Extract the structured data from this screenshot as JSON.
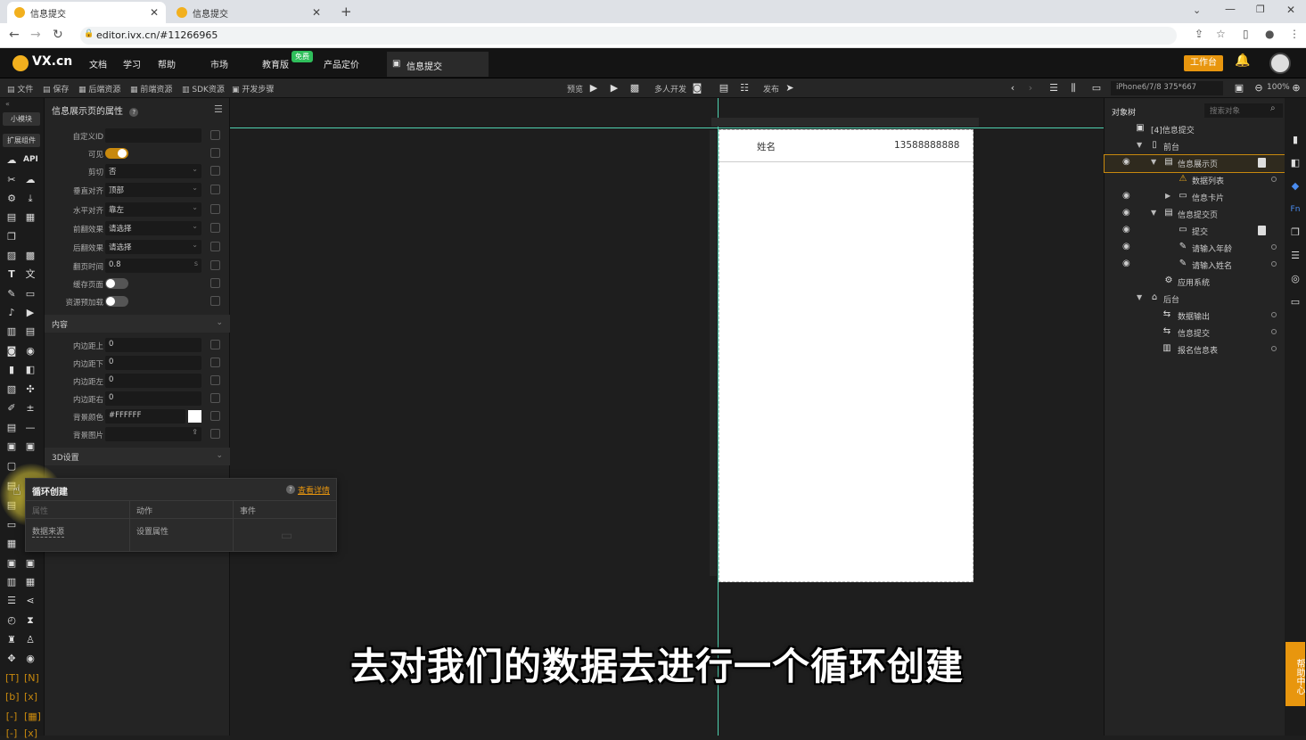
{
  "browser": {
    "tabs": [
      {
        "title": "信息提交"
      },
      {
        "title": "信息提交"
      }
    ],
    "url": "editor.ivx.cn/#11266965"
  },
  "app": {
    "logo": "VX.cn",
    "menu": [
      "文档",
      "学习",
      "帮助",
      "市场",
      "教育版",
      "产品定价"
    ],
    "menu_badge": "免费",
    "active_page_tab": "信息提交",
    "workbench_button": "工作台",
    "toolbar_left": [
      "文件",
      "保存",
      "后端资源",
      "前端资源",
      "SDK资源",
      "开发步骤"
    ],
    "preview_label": "预览",
    "multi_dev_label": "多人开发",
    "publish_label": "发布",
    "device_label": "iPhone6/7/8 375*667",
    "zoom_label": "100%"
  },
  "left_sidebar": {
    "tabs": [
      "小模块",
      "扩展组件"
    ],
    "api_label": "API"
  },
  "props_panel": {
    "title": "信息展示页的属性",
    "rows": [
      {
        "label": "自定义ID",
        "value": ""
      },
      {
        "label": "可见",
        "value": ""
      },
      {
        "label": "剪切",
        "value": "否"
      },
      {
        "label": "垂直对齐",
        "value": "顶部"
      },
      {
        "label": "水平对齐",
        "value": "靠左"
      },
      {
        "label": "前翻效果",
        "value": "请选择"
      },
      {
        "label": "后翻效果",
        "value": "请选择"
      },
      {
        "label": "翻页时间",
        "value": "0.8"
      },
      {
        "label": "缓存页面",
        "value": ""
      },
      {
        "label": "资源预加载",
        "value": ""
      }
    ],
    "page_time_unit": "s",
    "section_content": "内容",
    "content_rows": [
      {
        "label": "内边距上",
        "value": "0"
      },
      {
        "label": "内边距下",
        "value": "0"
      },
      {
        "label": "内边距左",
        "value": "0"
      },
      {
        "label": "内边距右",
        "value": "0"
      },
      {
        "label": "背景颜色",
        "value": "#FFFFFF"
      },
      {
        "label": "背景图片",
        "value": ""
      }
    ],
    "section_3d": "3D设置"
  },
  "popup": {
    "title": "循环创建",
    "help_link": "查看详情",
    "columns": [
      "属性",
      "动作",
      "事件"
    ],
    "row": [
      "数据来源",
      "设置属性"
    ]
  },
  "canvas": {
    "row_name": "姓名",
    "row_phone": "13588888888"
  },
  "object_tree": {
    "title": "对象树",
    "search_placeholder": "搜索对象",
    "nodes": [
      {
        "label": "[4]信息提交"
      },
      {
        "label": "前台"
      },
      {
        "label": "信息展示页"
      },
      {
        "label": "数据列表"
      },
      {
        "label": "信息卡片"
      },
      {
        "label": "信息提交页"
      },
      {
        "label": "提交"
      },
      {
        "label": "请输入年龄"
      },
      {
        "label": "请输入姓名"
      },
      {
        "label": "应用系统"
      },
      {
        "label": "后台"
      },
      {
        "label": "数据输出"
      },
      {
        "label": "信息提交"
      },
      {
        "label": "报名信息表"
      }
    ]
  },
  "help_center": "帮助中心",
  "subtitle": "去对我们的数据去进行一个循环创建",
  "colors": {
    "accent": "#c8890e",
    "bg": "#1e1e1e",
    "guide_line": "#4fd1b0"
  }
}
